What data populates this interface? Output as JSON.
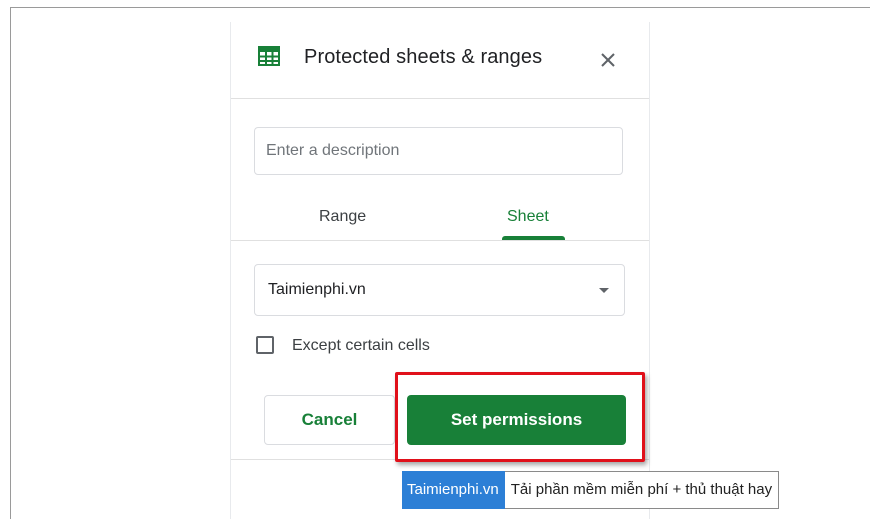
{
  "panel": {
    "title": "Protected sheets & ranges",
    "description_placeholder": "Enter a description",
    "description_value": ""
  },
  "tabs": [
    {
      "label": "Range",
      "active": false
    },
    {
      "label": "Sheet",
      "active": true
    }
  ],
  "sheet_select": {
    "selected": "Taimienphi.vn"
  },
  "except_cells": {
    "label": "Except certain cells",
    "checked": false
  },
  "actions": {
    "cancel_label": "Cancel",
    "set_label": "Set permissions"
  },
  "watermark": {
    "brand": "Taimienphi.vn",
    "tagline": "Tải phần mềm miễn phí + thủ thuật hay"
  },
  "colors": {
    "accent_green": "#188038",
    "highlight_red": "#e0101a",
    "watermark_blue": "#2c7fd6"
  },
  "icons": {
    "header": "sheets-grid-icon",
    "close": "close-icon",
    "dropdown": "dropdown-arrow-icon"
  }
}
